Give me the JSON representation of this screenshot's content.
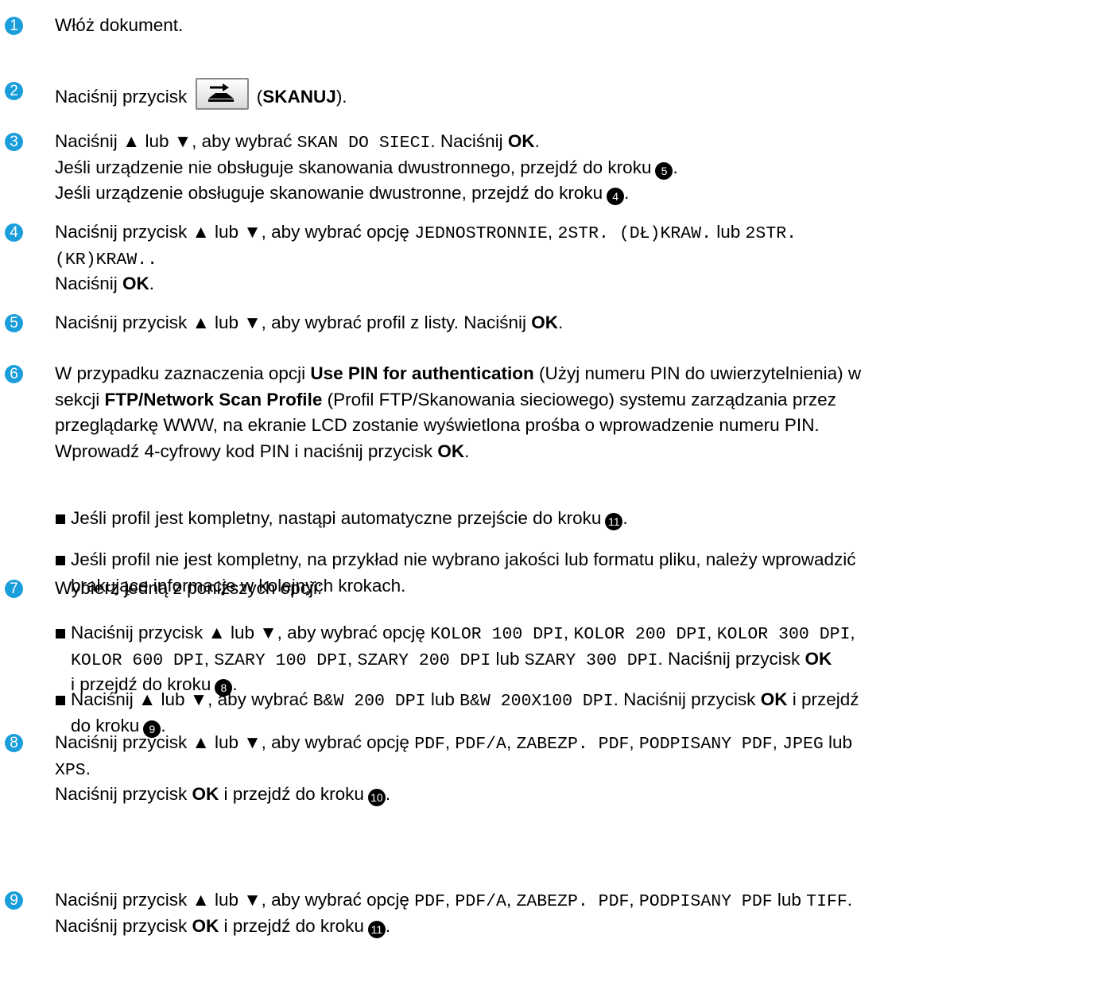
{
  "steps": [
    {
      "n": "1",
      "lines": [
        [
          {
            "t": "Włóż dokument."
          }
        ]
      ]
    },
    {
      "n": "2",
      "lines": [
        [
          {
            "t": "Naciśnij przycisk "
          },
          {
            "icon": "scan"
          },
          {
            "t": " ("
          },
          {
            "t": "SKANUJ",
            "b": true
          },
          {
            "t": ")."
          }
        ]
      ]
    },
    {
      "n": "3",
      "lines": [
        [
          {
            "t": "Naciśnij ▲ lub ▼, aby wybrać "
          },
          {
            "t": "SKAN DO SIECI",
            "m": true
          },
          {
            "t": ". Naciśnij "
          },
          {
            "t": "OK",
            "b": true
          },
          {
            "t": "."
          }
        ],
        [
          {
            "t": "Jeśli urządzenie nie obsługuje skanowania dwustronnego, przejdź do kroku"
          },
          {
            "ref": "5"
          },
          {
            "t": "."
          }
        ],
        [
          {
            "t": "Jeśli urządzenie obsługuje skanowanie dwustronne, przejdź do kroku"
          },
          {
            "ref": "4"
          },
          {
            "t": "."
          }
        ]
      ]
    },
    {
      "n": "4",
      "lines": [
        [
          {
            "t": "Naciśnij przycisk ▲ lub ▼, aby wybrać opcję "
          },
          {
            "t": "JEDNOSTRONNIE",
            "m": true
          },
          {
            "t": ", "
          },
          {
            "t": "2STR. (DŁ)KRAW.",
            "m": true
          },
          {
            "t": " lub "
          },
          {
            "t": "2STR.",
            "m": true
          }
        ],
        [
          {
            "t": "(KR)KRAW..",
            "m": true
          }
        ],
        [
          {
            "t": "Naciśnij "
          },
          {
            "t": "OK",
            "b": true
          },
          {
            "t": "."
          }
        ]
      ]
    },
    {
      "n": "5",
      "lines": [
        [
          {
            "t": "Naciśnij przycisk ▲ lub ▼, aby wybrać profil z listy. Naciśnij "
          },
          {
            "t": "OK",
            "b": true
          },
          {
            "t": "."
          }
        ]
      ]
    },
    {
      "n": "6",
      "lines": [
        [
          {
            "t": "W przypadku zaznaczenia opcji "
          },
          {
            "t": "Use PIN for authentication",
            "b": true
          },
          {
            "t": " (Użyj numeru PIN do uwierzytelnienia) w"
          }
        ],
        [
          {
            "t": "sekcji "
          },
          {
            "t": "FTP/Network Scan Profile",
            "b": true
          },
          {
            "t": " (Profil FTP/Skanowania sieciowego) systemu zarządzania przez"
          }
        ],
        [
          {
            "t": "przeglądarkę WWW, na ekranie LCD zostanie wyświetlona prośba o wprowadzenie numeru PIN."
          }
        ],
        [
          {
            "t": "Wprowadź 4-cyfrowy kod PIN i naciśnij przycisk "
          },
          {
            "t": "OK",
            "b": true
          },
          {
            "t": "."
          }
        ]
      ],
      "bullets": [
        [
          [
            {
              "t": "Jeśli profil jest kompletny, nastąpi automatyczne przejście do kroku"
            },
            {
              "ref": "11"
            },
            {
              "t": "."
            }
          ]
        ],
        [
          [
            {
              "t": "Jeśli profil nie jest kompletny, na przykład nie wybrano jakości lub formatu pliku, należy wprowadzić"
            }
          ],
          [
            {
              "t": "brakujące informacje w kolejnych krokach."
            }
          ]
        ]
      ]
    },
    {
      "n": "7",
      "lines": [
        [
          {
            "t": "Wybierz jedną z poniższych opcji:"
          }
        ]
      ],
      "bullets": [
        [
          [
            {
              "t": "Naciśnij przycisk ▲ lub ▼, aby wybrać opcję "
            },
            {
              "t": "KOLOR 100 DPI",
              "m": true
            },
            {
              "t": ", "
            },
            {
              "t": "KOLOR 200 DPI",
              "m": true
            },
            {
              "t": ", "
            },
            {
              "t": "KOLOR 300 DPI",
              "m": true
            },
            {
              "t": ","
            }
          ],
          [
            {
              "t": "KOLOR 600 DPI",
              "m": true
            },
            {
              "t": ", "
            },
            {
              "t": "SZARY 100 DPI",
              "m": true
            },
            {
              "t": ", "
            },
            {
              "t": "SZARY 200 DPI",
              "m": true
            },
            {
              "t": " lub "
            },
            {
              "t": "SZARY 300 DPI",
              "m": true
            },
            {
              "t": ". Naciśnij przycisk "
            },
            {
              "t": "OK",
              "b": true
            }
          ],
          [
            {
              "t": "i przejdź do kroku"
            },
            {
              "ref": "8"
            },
            {
              "t": "."
            }
          ]
        ],
        [
          [
            {
              "t": "Naciśnij ▲ lub ▼, aby wybrać "
            },
            {
              "t": "B&W 200 DPI",
              "m": true
            },
            {
              "t": " lub "
            },
            {
              "t": "B&W 200X100 DPI",
              "m": true
            },
            {
              "t": ". Naciśnij przycisk "
            },
            {
              "t": "OK",
              "b": true
            },
            {
              "t": " i przejdź"
            }
          ],
          [
            {
              "t": "do kroku"
            },
            {
              "ref": "9"
            },
            {
              "t": "."
            }
          ]
        ]
      ]
    },
    {
      "n": "8",
      "lines": [
        [
          {
            "t": "Naciśnij przycisk ▲ lub ▼, aby wybrać opcję "
          },
          {
            "t": "PDF",
            "m": true
          },
          {
            "t": ", "
          },
          {
            "t": "PDF/A",
            "m": true
          },
          {
            "t": ", "
          },
          {
            "t": "ZABEZP. PDF",
            "m": true
          },
          {
            "t": ", "
          },
          {
            "t": "PODPISANY PDF",
            "m": true
          },
          {
            "t": ", "
          },
          {
            "t": "JPEG",
            "m": true
          },
          {
            "t": " lub"
          }
        ],
        [
          {
            "t": "XPS",
            "m": true
          },
          {
            "t": "."
          }
        ],
        [
          {
            "t": "Naciśnij przycisk "
          },
          {
            "t": "OK",
            "b": true
          },
          {
            "t": " i przejdź do kroku"
          },
          {
            "ref": "10"
          },
          {
            "t": "."
          }
        ]
      ]
    },
    {
      "n": "9",
      "lines": [
        [
          {
            "t": "Naciśnij przycisk ▲ lub ▼, aby wybrać opcję "
          },
          {
            "t": "PDF",
            "m": true
          },
          {
            "t": ", "
          },
          {
            "t": "PDF/A",
            "m": true
          },
          {
            "t": ", "
          },
          {
            "t": "ZABEZP. PDF",
            "m": true
          },
          {
            "t": ", "
          },
          {
            "t": "PODPISANY PDF",
            "m": true
          },
          {
            "t": " lub "
          },
          {
            "t": "TIFF",
            "m": true
          },
          {
            "t": "."
          }
        ],
        [
          {
            "t": "Naciśnij przycisk "
          },
          {
            "t": "OK",
            "b": true
          },
          {
            "t": " i przejdź do kroku"
          },
          {
            "ref": "11"
          },
          {
            "t": "."
          }
        ]
      ]
    }
  ]
}
